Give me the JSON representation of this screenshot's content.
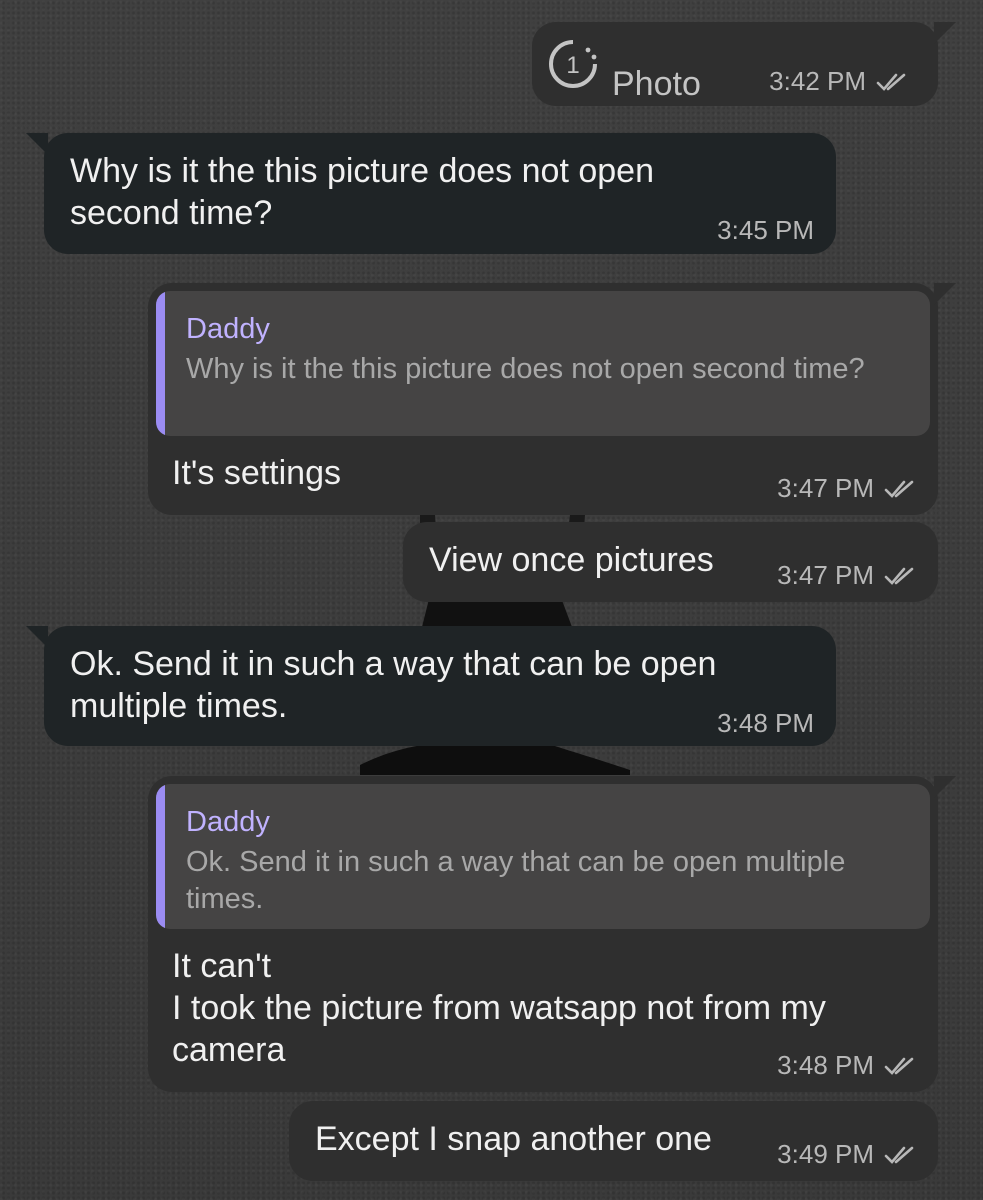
{
  "messages": [
    {
      "type": "photo",
      "label": "Photo",
      "time": "3:42 PM",
      "once_icon_text": "1"
    },
    {
      "type": "text",
      "text": "Why is it the this picture does not open second time?",
      "time": "3:45 PM"
    },
    {
      "type": "reply",
      "quote_author": "Daddy",
      "quote_text": "Why is it the this picture does not open second time?",
      "text": "It's settings",
      "time": "3:47 PM"
    },
    {
      "type": "text",
      "text": "View once pictures",
      "time": "3:47 PM"
    },
    {
      "type": "text",
      "text": "Ok. Send it in such a way that can be open multiple times.",
      "time": "3:48 PM"
    },
    {
      "type": "reply",
      "quote_author": "Daddy",
      "quote_text": "Ok. Send it in such a way that can be open multiple times.",
      "text": "It can't\nI took the picture from watsapp not from my camera",
      "time": "3:48 PM"
    },
    {
      "type": "text",
      "text": "Except I snap another one",
      "time": "3:49 PM"
    }
  ],
  "colors": {
    "incoming_bubble": "#1f2426",
    "outgoing_bubble": "#2f2f2f",
    "quote_accent": "#9b8cf2",
    "read_ticks": "#b8b8b8"
  },
  "icons": {
    "read_receipt": "double-check-icon",
    "view_once": "view-once-icon"
  }
}
